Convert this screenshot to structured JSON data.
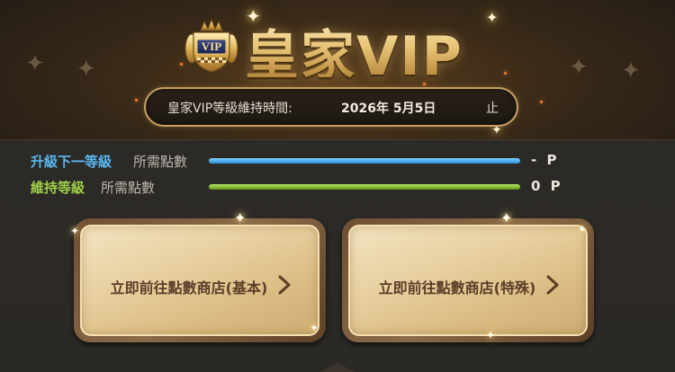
{
  "header": {
    "badge_text": "VIP",
    "title": "皇家VIP",
    "expiry": {
      "label": "皇家VIP等級維持時間:",
      "date": "2026年 5月5日",
      "suffix": "止"
    }
  },
  "progress": [
    {
      "title": "升級下一等級",
      "subtitle": "所需點數",
      "value": "- P",
      "fill_fraction": 1.0,
      "title_color": "#5ab8f0",
      "bar_color": "#3a9fe4"
    },
    {
      "title": "維持等級",
      "subtitle": "所需點數",
      "value": "0 P",
      "fill_fraction": 1.0,
      "title_color": "#9ed04a",
      "bar_color": "#7dbb2b"
    }
  ],
  "shop_buttons": [
    {
      "label": "立即前往點數商店(基本)",
      "icon": "chevron-right-icon"
    },
    {
      "label": "立即前往點數商店(特殊)",
      "icon": "chevron-right-icon"
    }
  ],
  "colors": {
    "accent_gold": "#c9a062",
    "button_text": "#5a3e28"
  }
}
